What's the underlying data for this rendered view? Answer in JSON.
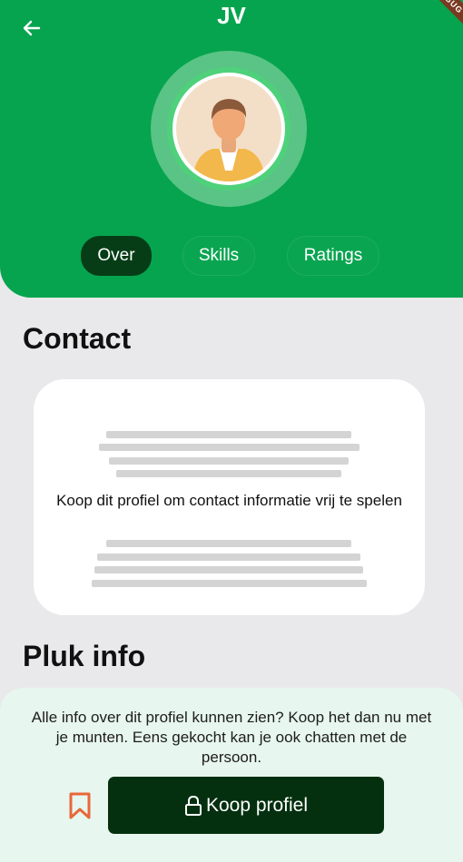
{
  "header": {
    "title": "JV",
    "back_icon": "arrow-left-icon",
    "debug_banner": "DEBUG",
    "background_color": "#06a44e"
  },
  "avatar": {
    "icon": "user-avatar-icon",
    "ring_color": "#4fd17b"
  },
  "tabs": [
    {
      "label": "Over",
      "active": true
    },
    {
      "label": "Skills",
      "active": false
    },
    {
      "label": "Ratings",
      "active": false
    }
  ],
  "contact": {
    "section_title": "Contact",
    "locked_message": "Koop dit profiel om contact informatie vrij te spelen"
  },
  "pluk_info": {
    "section_title": "Pluk info"
  },
  "purchase_panel": {
    "message": "Alle info over dit profiel kunnen zien? Koop het dan nu met je munten. Eens gekocht kan je ook chatten met de persoon.",
    "bookmark_icon": "bookmark-icon",
    "lock_icon": "lock-icon",
    "buy_label": "Koop profiel",
    "button_color": "#04300f"
  }
}
